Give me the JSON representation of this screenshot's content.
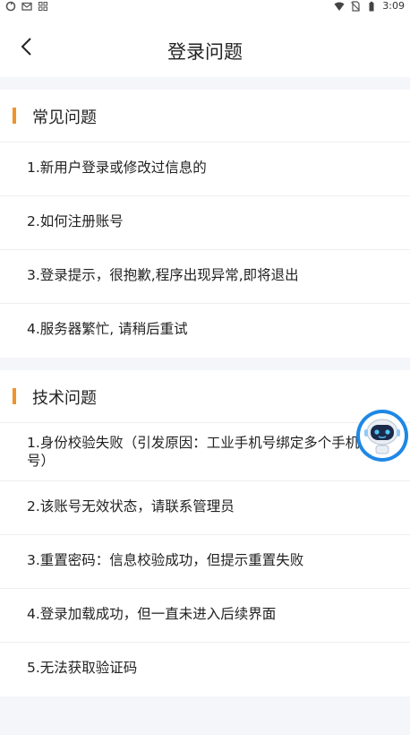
{
  "status_bar": {
    "time": "3:09",
    "left_icons": [
      "sync-icon",
      "mail-icon",
      "grid-icon"
    ],
    "right_icons": [
      "wifi-icon",
      "no-sim-icon",
      "battery-icon"
    ]
  },
  "header": {
    "title": "登录问题",
    "back_icon": "chevron-left-icon"
  },
  "sections": [
    {
      "title": "常见问题",
      "items": [
        "1.新用户登录或修改过信息的",
        "2.如何注册账号",
        "3.登录提示，很抱歉,程序出现异常,即将退出",
        "4.服务器繁忙, 请稍后重试"
      ]
    },
    {
      "title": "技术问题",
      "items": [
        "1.身份校验失败（引发原因：工业手机号绑定多个手机号）",
        "2.该账号无效状态，请联系管理员",
        "3.重置密码：信息校验成功，但提示重置失败",
        "4.登录加载成功，但一直未进入后续界面",
        "5.无法获取验证码"
      ]
    }
  ],
  "colors": {
    "accent": "#f0932b",
    "robot": "#1e88e5"
  },
  "assistant_icon": "robot-assistant-icon"
}
